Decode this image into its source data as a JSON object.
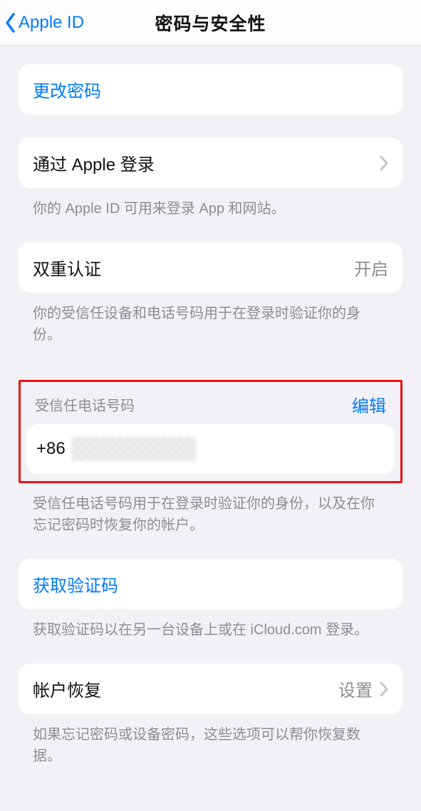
{
  "nav": {
    "back_label": "Apple ID",
    "title": "密码与安全性"
  },
  "change_password": {
    "label": "更改密码"
  },
  "sign_in_apple": {
    "label": "通过 Apple 登录",
    "footer": "你的 Apple ID 可用来登录 App 和网站。"
  },
  "two_factor": {
    "label": "双重认证",
    "value": "开启",
    "footer": "你的受信任设备和电话号码用于在登录时验证你的身份。"
  },
  "trusted_phone": {
    "header": "受信任电话号码",
    "edit_label": "编辑",
    "prefix": "+86",
    "footer": "受信任电话号码用于在登录时验证你的身份，以及在你忘记密码时恢复你的帐户。"
  },
  "get_code": {
    "label": "获取验证码",
    "footer": "获取验证码以在另一台设备上或在 iCloud.com 登录。"
  },
  "account_recovery": {
    "label": "帐户恢复",
    "value": "设置",
    "footer": "如果忘记密码或设备密码，这些选项可以帮你恢复数据。"
  }
}
